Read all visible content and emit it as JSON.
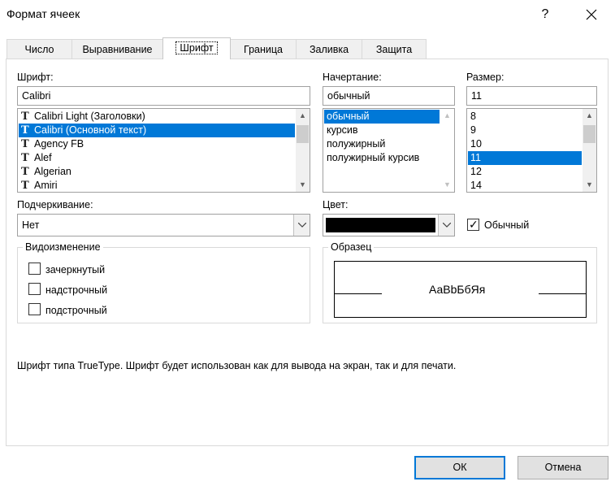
{
  "dialog": {
    "title": "Формат ячеек",
    "help_label": "?",
    "close_label": "✕"
  },
  "tabs": [
    {
      "label": "Число"
    },
    {
      "label": "Выравнивание"
    },
    {
      "label": "Шрифт",
      "active": true
    },
    {
      "label": "Граница"
    },
    {
      "label": "Заливка"
    },
    {
      "label": "Защита"
    }
  ],
  "font": {
    "label": "Шрифт:",
    "value": "Calibri",
    "items": [
      {
        "label": "Calibri Light (Заголовки)"
      },
      {
        "label": "Calibri (Основной текст)",
        "selected": true
      },
      {
        "label": "Agency FB"
      },
      {
        "label": "Alef"
      },
      {
        "label": "Algerian"
      },
      {
        "label": "Amiri"
      }
    ],
    "item_icon": "truetype-icon"
  },
  "style": {
    "label": "Начертание:",
    "value": "обычный",
    "items": [
      {
        "label": "обычный",
        "selected": true
      },
      {
        "label": "курсив"
      },
      {
        "label": "полужирный"
      },
      {
        "label": "полужирный курсив"
      }
    ]
  },
  "size": {
    "label": "Размер:",
    "value": "11",
    "items": [
      {
        "label": "8"
      },
      {
        "label": "9"
      },
      {
        "label": "10"
      },
      {
        "label": "11",
        "selected": true
      },
      {
        "label": "12"
      },
      {
        "label": "14"
      }
    ]
  },
  "underline": {
    "label": "Подчеркивание:",
    "value": "Нет"
  },
  "color": {
    "label": "Цвет:",
    "swatch": "#000000",
    "normal_label": "Обычный",
    "normal_checked": true
  },
  "effects": {
    "title": "Видоизменение",
    "items": [
      {
        "label": "зачеркнутый",
        "checked": false
      },
      {
        "label": "надстрочный",
        "checked": false
      },
      {
        "label": "подстрочный",
        "checked": false
      }
    ]
  },
  "preview": {
    "title": "Образец",
    "text": "АаВbБбЯя"
  },
  "info_text": "Шрифт типа TrueType. Шрифт будет использован как для вывода на экран, так и для печати.",
  "buttons": {
    "ok": "ОК",
    "cancel": "Отмена"
  },
  "colors": {
    "selection": "#0078d7",
    "dialog_bg": "#ffffff",
    "button_bg": "#e1e1e1"
  }
}
